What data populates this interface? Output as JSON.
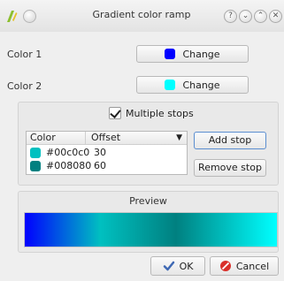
{
  "window": {
    "title": "Gradient color ramp",
    "controls": [
      "help-icon",
      "minimize-icon",
      "maximize-icon",
      "close-icon"
    ]
  },
  "color1": {
    "label": "Color 1",
    "button_label": "Change",
    "swatch_color": "#0000ff"
  },
  "color2": {
    "label": "Color 2",
    "button_label": "Change",
    "swatch_color": "#00ffff"
  },
  "multiple_stops": {
    "label": "Multiple stops",
    "checked": true,
    "columns": [
      "Color",
      "Offset"
    ],
    "rows": [
      {
        "color": "#00c0c0",
        "offset": "30"
      },
      {
        "color": "#008080",
        "offset": "60"
      }
    ],
    "add_button": "Add stop",
    "remove_button": "Remove stop"
  },
  "preview": {
    "title": "Preview",
    "gradient_stops": [
      {
        "color": "#0000ff",
        "position": 0
      },
      {
        "color": "#00c0c0",
        "position": 30
      },
      {
        "color": "#008080",
        "position": 60
      },
      {
        "color": "#00ffff",
        "position": 100
      }
    ]
  },
  "buttons": {
    "ok": "OK",
    "cancel": "Cancel"
  },
  "colors": {
    "accent": "#2a62c8",
    "cancel_red": "#d9302b"
  }
}
